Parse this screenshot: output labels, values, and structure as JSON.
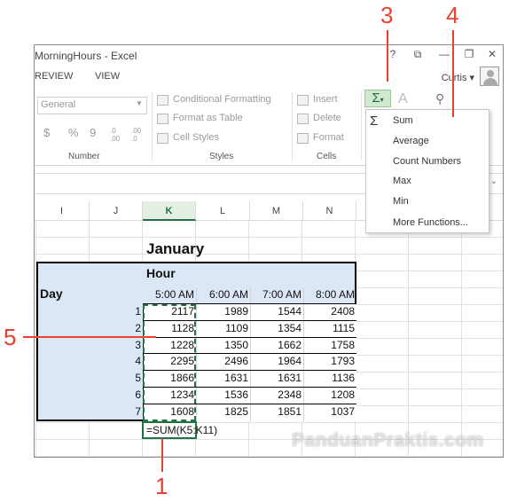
{
  "window": {
    "title": "MorningHours - Excel",
    "controls": [
      "?",
      "⧉",
      "—",
      "❐",
      "✕"
    ],
    "user": "Curtis"
  },
  "tabs": [
    "REVIEW",
    "VIEW"
  ],
  "ribbon": {
    "number_format": "General",
    "number_symbols": [
      "$",
      "%",
      "9"
    ],
    "decimal_buttons": [
      ".0 .00",
      ".00 .0"
    ],
    "number_group": "Number",
    "styles": [
      "Conditional Formatting",
      "Format as Table",
      "Cell Styles"
    ],
    "styles_group": "Styles",
    "cells": [
      "Insert",
      "Delete",
      "Format"
    ],
    "cells_group": "Cells"
  },
  "autosum_menu": [
    "Sum",
    "Average",
    "Count Numbers",
    "Max",
    "Min",
    "More Functions..."
  ],
  "columns": [
    "I",
    "J",
    "K",
    "L",
    "M",
    "N"
  ],
  "sheet": {
    "title": "January",
    "hour_label": "Hour",
    "day_label": "Day",
    "hours": [
      "5:00 AM",
      "6:00 AM",
      "7:00 AM",
      "8:00 AM"
    ],
    "days": [
      "1",
      "2",
      "3",
      "4",
      "5",
      "6",
      "7"
    ],
    "values": [
      [
        2117,
        1989,
        1544,
        2408
      ],
      [
        1128,
        1109,
        1354,
        1115
      ],
      [
        1228,
        1350,
        1662,
        1758
      ],
      [
        2295,
        2496,
        1964,
        1793
      ],
      [
        1866,
        1631,
        1631,
        1136
      ],
      [
        1234,
        1536,
        2348,
        1208
      ],
      [
        1608,
        1825,
        1851,
        1037
      ]
    ],
    "formula": "=SUM(K5:K11)"
  },
  "callouts": [
    "1",
    "3",
    "4",
    "5"
  ],
  "watermark": "PanduanPraktis.com"
}
